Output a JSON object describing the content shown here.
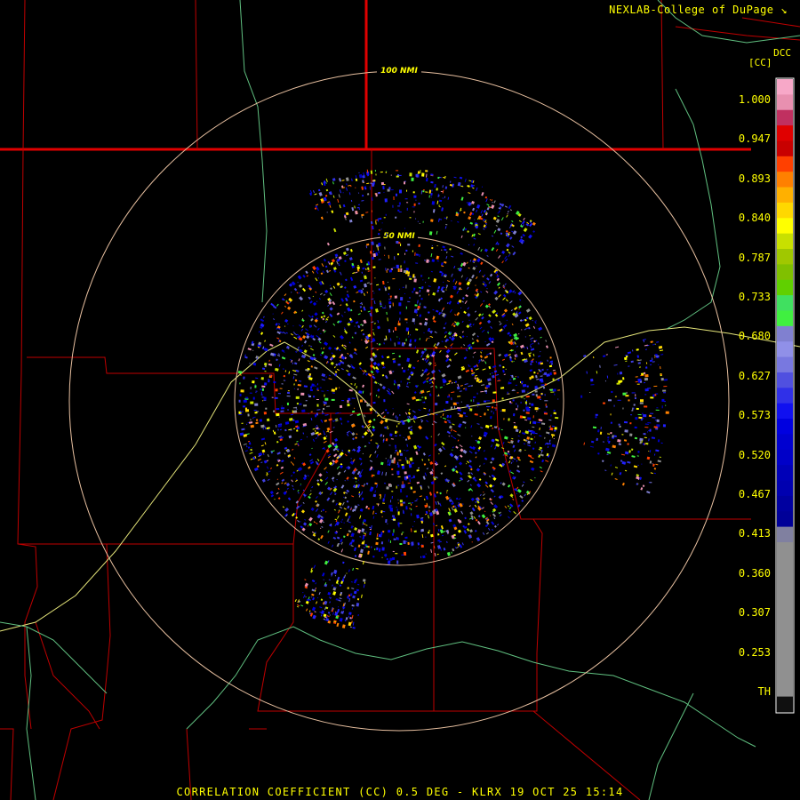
{
  "credit": "NEXLAB-College of DuPage",
  "site_code": "DCC",
  "product_unit": "[CC]",
  "footer": "CORRELATION COEFFICIENT (CC) 0.5 DEG - KLRX 19 OCT 25 15:14",
  "range_rings": [
    {
      "label": "50 NMI",
      "range_nmi": 50
    },
    {
      "label": "100 NMI",
      "range_nmi": 100
    }
  ],
  "colorbar": {
    "ticks": [
      "1.000",
      "0.947",
      "0.893",
      "0.840",
      "0.787",
      "0.733",
      "0.680",
      "0.627",
      "0.573",
      "0.520",
      "0.467",
      "0.413",
      "0.360",
      "0.307",
      "0.253",
      "TH"
    ],
    "colors": [
      "#f7a8c8",
      "#e890b0",
      "#c03060",
      "#e00000",
      "#c80000",
      "#ff4000",
      "#ff8000",
      "#ffb000",
      "#ffd800",
      "#ffff00",
      "#c8e000",
      "#a0c800",
      "#80c000",
      "#60d000",
      "#40e060",
      "#40f040",
      "#8080d0",
      "#9090e8",
      "#7878e0",
      "#5050e0",
      "#3030e8",
      "#1010f0",
      "#0000e0",
      "#0000d0",
      "#0000c8",
      "#0000b8",
      "#0000b0",
      "#0000a0",
      "#000098",
      "#8080a0",
      "#909090",
      "#909090",
      "#909090",
      "#909090",
      "#909090",
      "#909090",
      "#909090",
      "#909090",
      "#909090",
      "#909090",
      "#101010"
    ]
  }
}
